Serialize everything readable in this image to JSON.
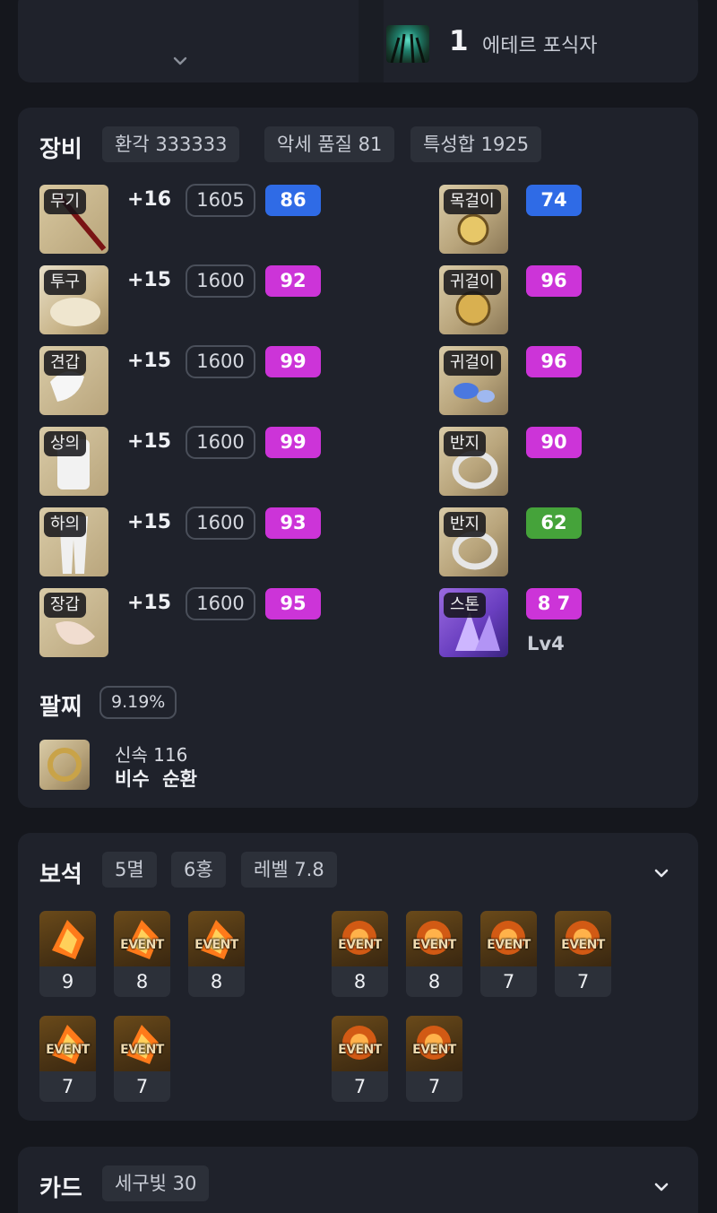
{
  "top": {
    "rank": "1",
    "engraving_name": "에테르 포식자",
    "icon": "aether-predator-icon"
  },
  "equipment": {
    "title": "장비",
    "tags": [
      "환각 333333",
      "악세 품질 81",
      "특성합 1925"
    ],
    "gear": [
      {
        "slot": "무기",
        "enhance": "+16",
        "ilvl": "1605",
        "quality": "86",
        "quality_color": "#2f6be6",
        "icon": "weapon-icon"
      },
      {
        "slot": "투구",
        "enhance": "+15",
        "ilvl": "1600",
        "quality": "92",
        "quality_color": "#cc34d8",
        "icon": "helmet-icon"
      },
      {
        "slot": "견갑",
        "enhance": "+15",
        "ilvl": "1600",
        "quality": "99",
        "quality_color": "#cc34d8",
        "icon": "shoulder-icon"
      },
      {
        "slot": "상의",
        "enhance": "+15",
        "ilvl": "1600",
        "quality": "99",
        "quality_color": "#cc34d8",
        "icon": "chest-icon"
      },
      {
        "slot": "하의",
        "enhance": "+15",
        "ilvl": "1600",
        "quality": "93",
        "quality_color": "#cc34d8",
        "icon": "pants-icon"
      },
      {
        "slot": "장갑",
        "enhance": "+15",
        "ilvl": "1600",
        "quality": "95",
        "quality_color": "#cc34d8",
        "icon": "gloves-icon"
      }
    ],
    "accessories": [
      {
        "slot": "목걸이",
        "quality": "74",
        "quality_color": "#2f6be6",
        "icon": "necklace-icon"
      },
      {
        "slot": "귀걸이",
        "quality": "96",
        "quality_color": "#cc34d8",
        "icon": "earring-icon"
      },
      {
        "slot": "귀걸이",
        "quality": "96",
        "quality_color": "#cc34d8",
        "icon": "earring-icon"
      },
      {
        "slot": "반지",
        "quality": "90",
        "quality_color": "#cc34d8",
        "icon": "ring-icon"
      },
      {
        "slot": "반지",
        "quality": "62",
        "quality_color": "#45a33a",
        "icon": "ring-icon"
      },
      {
        "slot": "스톤",
        "quality": "8 7",
        "quality_color": "#cc34d8",
        "icon": "ability-stone-icon",
        "level": "Lv4"
      }
    ],
    "bracelet": {
      "title": "팔찌",
      "tag": "9.19%",
      "line1": "신속 116",
      "line2": "비수  순환",
      "icon": "bracelet-icon"
    }
  },
  "gems": {
    "title": "보석",
    "tags": [
      "5멸",
      "6홍",
      "레벨 7.8"
    ],
    "event_label": "EVENT",
    "row1_left": [
      {
        "level": "9",
        "event": false,
        "kind": "doom"
      },
      {
        "level": "8",
        "event": true,
        "kind": "doom"
      },
      {
        "level": "8",
        "event": true,
        "kind": "doom"
      }
    ],
    "row1_right": [
      {
        "level": "8",
        "event": true,
        "kind": "bloom"
      },
      {
        "level": "8",
        "event": true,
        "kind": "bloom"
      },
      {
        "level": "7",
        "event": true,
        "kind": "bloom"
      },
      {
        "level": "7",
        "event": true,
        "kind": "bloom"
      }
    ],
    "row2_left": [
      {
        "level": "7",
        "event": true,
        "kind": "doom"
      },
      {
        "level": "7",
        "event": true,
        "kind": "doom"
      }
    ],
    "row2_right": [
      {
        "level": "7",
        "event": true,
        "kind": "bloom"
      },
      {
        "level": "7",
        "event": true,
        "kind": "bloom"
      }
    ]
  },
  "cards": {
    "title": "카드",
    "tag": "세구빛 30"
  }
}
